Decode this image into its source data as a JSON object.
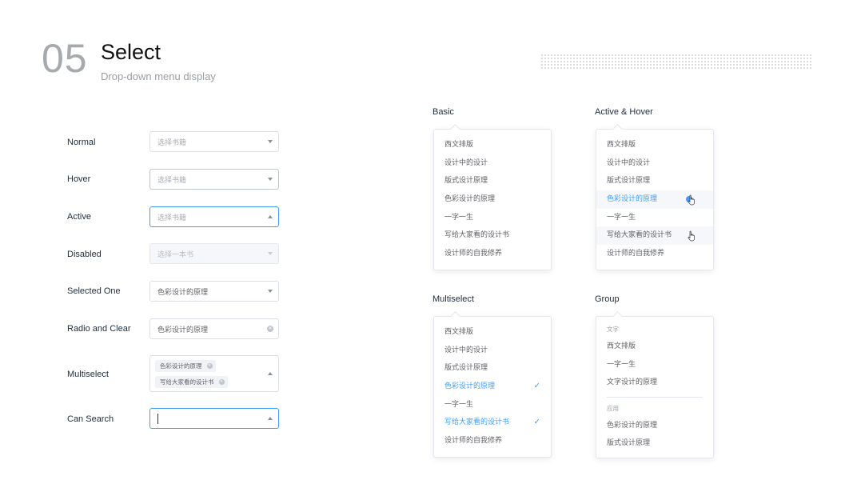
{
  "header": {
    "number": "05",
    "title": "Select",
    "subtitle": "Drop-down menu display"
  },
  "rows": {
    "normal": {
      "label": "Normal",
      "placeholder": "选择书籍"
    },
    "hover": {
      "label": "Hover",
      "placeholder": "选择书籍"
    },
    "active": {
      "label": "Active",
      "placeholder": "选择书籍"
    },
    "disabled": {
      "label": "Disabled",
      "placeholder": "选择一本书"
    },
    "selected_one": {
      "label": "Selected One",
      "value": "色彩设计的原理"
    },
    "radio_clear": {
      "label": "Radio and Clear",
      "value": "色彩设计的原理"
    },
    "multiselect": {
      "label": "Multiselect",
      "tags": [
        "色彩设计的原理",
        "写给大家看的设计书"
      ]
    },
    "can_search": {
      "label": "Can Search",
      "value": ""
    }
  },
  "options": [
    "西文排版",
    "设计中的设计",
    "版式设计原理",
    "色彩设计的原理",
    "一字一生",
    "写给大家看的设计书",
    "设计师的自我修养"
  ],
  "panels": {
    "basic": {
      "title": "Basic"
    },
    "active_hover": {
      "title": "Active & Hover",
      "active_index": 3,
      "hover_index": 5
    },
    "multiselect": {
      "title": "Multiselect",
      "selected_indices": [
        3,
        5
      ]
    },
    "group": {
      "title": "Group",
      "groups": [
        {
          "name": "文字",
          "items": [
            "西文排版",
            "一字一生",
            "文字设计的原理"
          ]
        },
        {
          "name": "应用",
          "items": [
            "色彩设计的原理",
            "版式设计原理"
          ]
        }
      ]
    }
  },
  "colors": {
    "accent": "#409eff",
    "border": "#dcdfe6",
    "text": "#606266",
    "placeholder": "#a8abb2"
  },
  "icons": {
    "dropdown_arrow": "chevron-down-icon",
    "clear": "clear-icon",
    "check": "check-icon",
    "pointer": "hand-cursor-icon"
  }
}
